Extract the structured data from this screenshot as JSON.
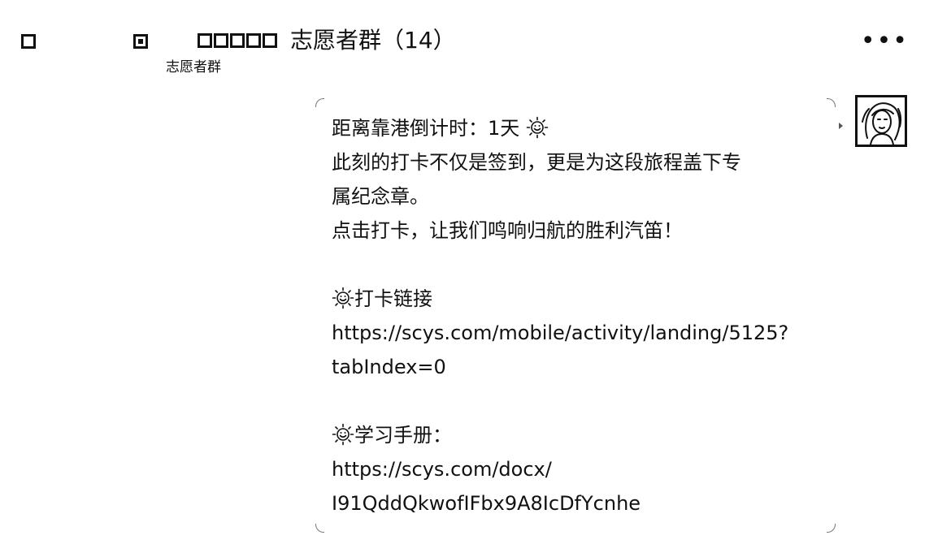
{
  "header": {
    "title": "志愿者群（14）",
    "subtitle": "志愿者群",
    "more_label": "•••"
  },
  "message": {
    "line1": "距离靠港倒计时：1天",
    "line2": "此刻的打卡不仅是签到，更是为这段旅程盖下专",
    "line3": "属纪念章。",
    "line4": "点击打卡，让我们鸣响归航的胜利汽笛！",
    "section1_label": "打卡链接",
    "link1_part1": "https://scys.com/mobile/activity/landing/5125?",
    "link1_part2": "tabIndex=0",
    "section2_label": "学习手册：",
    "link2_part1": "https://scys.com/docx/",
    "link2_part2": "I91QddQkwofIFbx9A8IcDfYcnhe"
  },
  "icons": {
    "back": "back-icon",
    "nav": "nav-icon",
    "sun_emoji": "sun-emoji-icon",
    "more": "more-icon",
    "avatar": "avatar"
  }
}
